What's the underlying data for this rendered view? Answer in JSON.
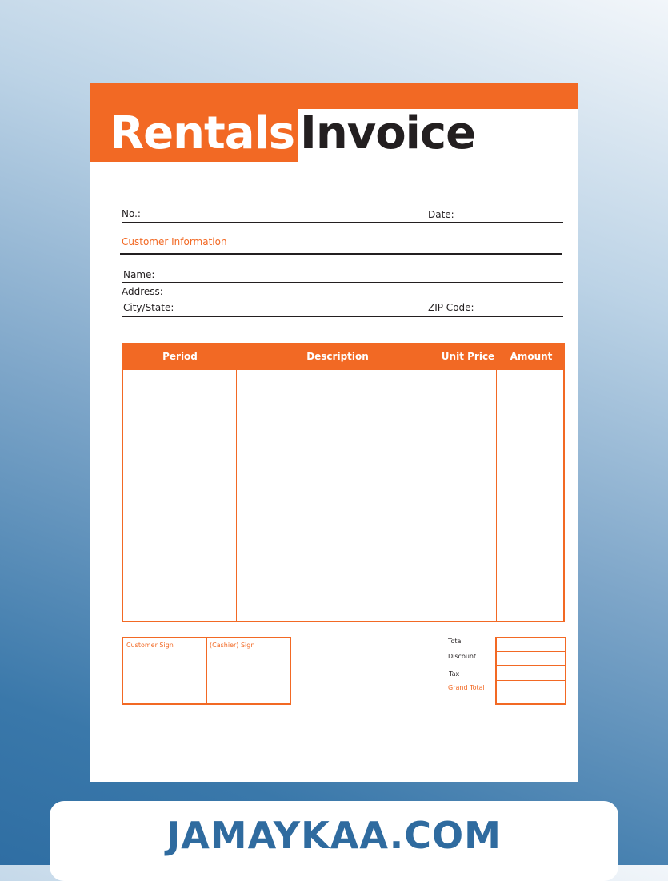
{
  "header": {
    "title_part1": "Rentals",
    "title_part2": "Invoice"
  },
  "fields": {
    "no_label": "No.:",
    "date_label": "Date:",
    "customer_info_heading": "Customer Information",
    "name_label": "Name:",
    "address_label": "Address:",
    "city_state_label": "City/State:",
    "zip_label": "ZIP Code:"
  },
  "items_table": {
    "columns": [
      "Period",
      "Description",
      "Unit Price",
      "Amount"
    ]
  },
  "signatures": {
    "customer_sign": "Customer Sign",
    "cashier_sign": "(Cashier) Sign"
  },
  "totals": {
    "total_label": "Total",
    "discount_label": "Discount",
    "tax_label": "Tax",
    "grand_total_label": "Grand Total"
  },
  "footer": {
    "site": "JAMAYKAA.COM"
  },
  "colors": {
    "accent": "#f26924",
    "dark_text": "#231f20",
    "footer_text": "#2f6b9f"
  }
}
